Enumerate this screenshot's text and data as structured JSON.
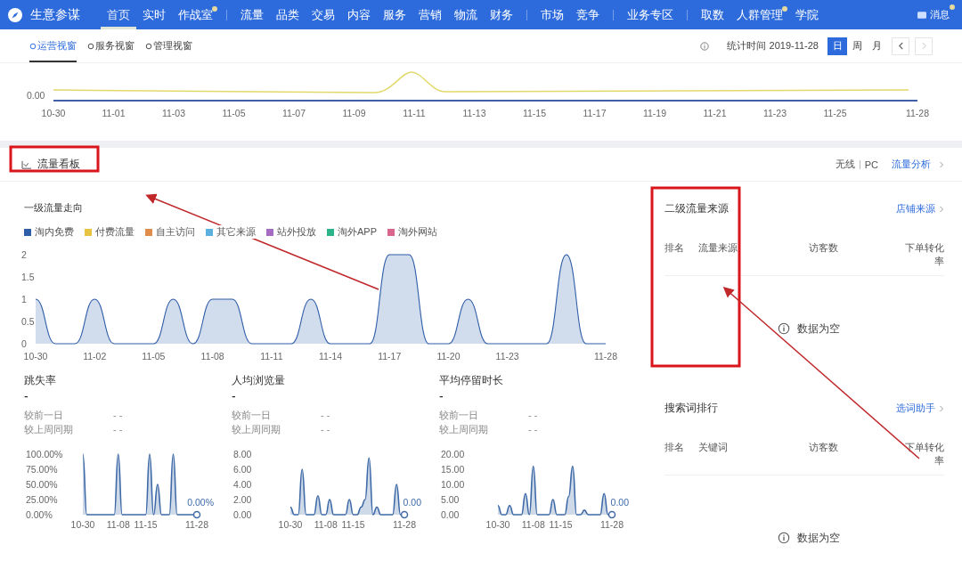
{
  "nav": {
    "brand": "生意参谋",
    "groups": [
      [
        {
          "label": "首页",
          "selected": true,
          "badge": false
        },
        {
          "label": "实时",
          "selected": false,
          "badge": false
        },
        {
          "label": "作战室",
          "selected": false,
          "badge": true
        }
      ],
      [
        {
          "label": "流量",
          "selected": false,
          "badge": false
        },
        {
          "label": "品类",
          "selected": false,
          "badge": false
        },
        {
          "label": "交易",
          "selected": false,
          "badge": false
        },
        {
          "label": "内容",
          "selected": false,
          "badge": false
        },
        {
          "label": "服务",
          "selected": false,
          "badge": false
        },
        {
          "label": "营销",
          "selected": false,
          "badge": false
        },
        {
          "label": "物流",
          "selected": false,
          "badge": false
        },
        {
          "label": "财务",
          "selected": false,
          "badge": false
        }
      ],
      [
        {
          "label": "市场",
          "selected": false,
          "badge": false
        },
        {
          "label": "竞争",
          "selected": false,
          "badge": false
        }
      ],
      [
        {
          "label": "业务专区",
          "selected": false,
          "badge": false
        }
      ],
      [
        {
          "label": "取数",
          "selected": false,
          "badge": false
        },
        {
          "label": "人群管理",
          "selected": false,
          "badge": true
        },
        {
          "label": "学院",
          "selected": false,
          "badge": false
        }
      ]
    ],
    "message": {
      "label": "消息",
      "badge": true
    }
  },
  "subbar": {
    "tabs": [
      {
        "label": "运营视窗",
        "selected": true
      },
      {
        "label": "服务视窗",
        "selected": false
      },
      {
        "label": "管理视窗",
        "selected": false
      }
    ],
    "stat_time": "统计时间 2019-11-28",
    "periods": [
      {
        "label": "日",
        "selected": true
      },
      {
        "label": "周",
        "selected": false
      },
      {
        "label": "月",
        "selected": false
      }
    ],
    "prev_disabled": false,
    "next_disabled": true
  },
  "top_chart": {
    "y_label": "0.00",
    "x_labels": [
      "10-30",
      "11-01",
      "11-03",
      "11-05",
      "11-07",
      "11-09",
      "11-11",
      "11-13",
      "11-15",
      "11-17",
      "11-19",
      "11-21",
      "11-23",
      "11-25",
      "11-28"
    ]
  },
  "board": {
    "title": "流量看板",
    "devices": [
      "无线",
      "PC"
    ],
    "link": "流量分析",
    "main": {
      "title": "一级流量走向",
      "legend": [
        {
          "name": "淘内免费",
          "color": "#2f5ea8"
        },
        {
          "name": "付费流量",
          "color": "#e6c441"
        },
        {
          "name": "自主访问",
          "color": "#e08c4a"
        },
        {
          "name": "其它来源",
          "color": "#5ab1e0"
        },
        {
          "name": "站外投放",
          "color": "#a66cc4"
        },
        {
          "name": "淘外APP",
          "color": "#2bb38a"
        },
        {
          "name": "淘外网站",
          "color": "#d9668c"
        }
      ],
      "chart_data": {
        "type": "area",
        "categories": [
          "10-30",
          null,
          null,
          "11-02",
          null,
          null,
          "11-05",
          null,
          null,
          "11-08",
          null,
          null,
          "11-11",
          null,
          null,
          "11-14",
          null,
          null,
          "11-17",
          null,
          null,
          "11-20",
          null,
          null,
          "11-23",
          null,
          null,
          null,
          null,
          "11-28"
        ],
        "series": [
          {
            "color": "#2f5ea8",
            "values": [
              1,
              0,
              0,
              1,
              0,
              0,
              0,
              1,
              0,
              1,
              1,
              0,
              0,
              0,
              1,
              0,
              0,
              0,
              2,
              2,
              0,
              0,
              1,
              0,
              0,
              0,
              0,
              2,
              0,
              0
            ]
          }
        ],
        "ylim": [
          0,
          2
        ],
        "yticks": [
          0,
          {
            "value": 0.5,
            "label": "0.5"
          },
          1,
          {
            "value": 1.5,
            "label": "1.5"
          },
          2
        ]
      }
    },
    "metrics": [
      {
        "title": "跳失率",
        "value": "-",
        "compare": [
          {
            "label": "较前一日",
            "value": "- -"
          },
          {
            "label": "较上周同期",
            "value": "- -"
          }
        ],
        "chart_data": {
          "type": "area",
          "categories": [
            "10-30",
            null,
            null,
            null,
            null,
            null,
            null,
            null,
            null,
            "11-08",
            null,
            null,
            null,
            null,
            null,
            null,
            "11-15",
            null,
            null,
            null,
            null,
            null,
            null,
            null,
            null,
            null,
            null,
            null,
            null,
            "11-28"
          ],
          "series": [
            {
              "color": "#3f6aa8",
              "values": [
                100,
                0,
                0,
                0,
                0,
                0,
                0,
                0,
                0,
                100,
                0,
                0,
                0,
                0,
                0,
                0,
                0,
                100,
                0,
                50,
                0,
                0,
                0,
                100,
                0,
                0,
                0,
                0,
                0,
                0
              ]
            }
          ],
          "ylim": [
            0,
            100
          ],
          "yticks": [
            {
              "value": 0,
              "label": "0.00%"
            },
            {
              "value": 25,
              "label": "25.00%"
            },
            {
              "value": 50,
              "label": "50.00%"
            },
            {
              "value": 75,
              "label": "75.00%"
            },
            {
              "value": 100,
              "label": "100.00%"
            }
          ],
          "annotations": [
            "0.00%"
          ]
        }
      },
      {
        "title": "人均浏览量",
        "value": "-",
        "compare": [
          {
            "label": "较前一日",
            "value": "- -"
          },
          {
            "label": "较上周同期",
            "value": "- -"
          }
        ],
        "chart_data": {
          "type": "area",
          "categories": [
            "10-30",
            null,
            null,
            null,
            null,
            null,
            null,
            null,
            null,
            "11-08",
            null,
            null,
            null,
            null,
            null,
            null,
            "11-15",
            null,
            null,
            null,
            null,
            null,
            null,
            null,
            null,
            null,
            null,
            null,
            null,
            "11-28"
          ],
          "series": [
            {
              "color": "#3f6aa8",
              "values": [
                1,
                0,
                0,
                6,
                0,
                0,
                0,
                2.5,
                0,
                0,
                2,
                0,
                0,
                0,
                0,
                2,
                0,
                0,
                1,
                2,
                7.5,
                0,
                1,
                0,
                0,
                0,
                0,
                4,
                0,
                0
              ]
            }
          ],
          "ylim": [
            0,
            8
          ],
          "yticks": [
            {
              "value": 0,
              "label": "0.00"
            },
            {
              "value": 2,
              "label": "2.00"
            },
            {
              "value": 4,
              "label": "4.00"
            },
            {
              "value": 6,
              "label": "6.00"
            },
            {
              "value": 8,
              "label": "8.00"
            }
          ],
          "annotations": [
            "0.00"
          ]
        }
      },
      {
        "title": "平均停留时长",
        "value": "-",
        "compare": [
          {
            "label": "较前一日",
            "value": "- -"
          },
          {
            "label": "较上周同期",
            "value": "- -"
          }
        ],
        "chart_data": {
          "type": "area",
          "categories": [
            "10-30",
            null,
            null,
            null,
            null,
            null,
            null,
            null,
            null,
            "11-08",
            null,
            null,
            null,
            null,
            null,
            null,
            "11-15",
            null,
            null,
            null,
            null,
            null,
            null,
            null,
            null,
            null,
            null,
            null,
            null,
            "11-28"
          ],
          "series": [
            {
              "color": "#3f6aa8",
              "values": [
                3,
                0,
                0,
                3,
                0,
                0,
                0,
                7,
                0,
                16,
                0,
                0,
                0,
                0,
                5,
                0,
                0,
                0,
                6,
                16,
                0,
                0,
                1.5,
                0,
                0,
                0,
                0,
                7,
                0,
                0
              ]
            }
          ],
          "ylim": [
            0,
            20
          ],
          "yticks": [
            {
              "value": 0,
              "label": "0.00"
            },
            {
              "value": 5,
              "label": "5.00"
            },
            {
              "value": 10,
              "label": "10.00"
            },
            {
              "value": 15,
              "label": "15.00"
            },
            {
              "value": 20,
              "label": "20.00"
            }
          ],
          "annotations": [
            "0.00"
          ]
        }
      }
    ],
    "panels": [
      {
        "title": "二级流量来源",
        "link": "店铺来源",
        "columns": [
          "排名",
          "流量来源",
          "访客数",
          "下单转化率"
        ],
        "empty": "数据为空"
      },
      {
        "title": "搜索词排行",
        "link": "选词助手",
        "columns": [
          "排名",
          "关键词",
          "访客数",
          "下单转化率"
        ],
        "empty": "数据为空"
      }
    ]
  }
}
